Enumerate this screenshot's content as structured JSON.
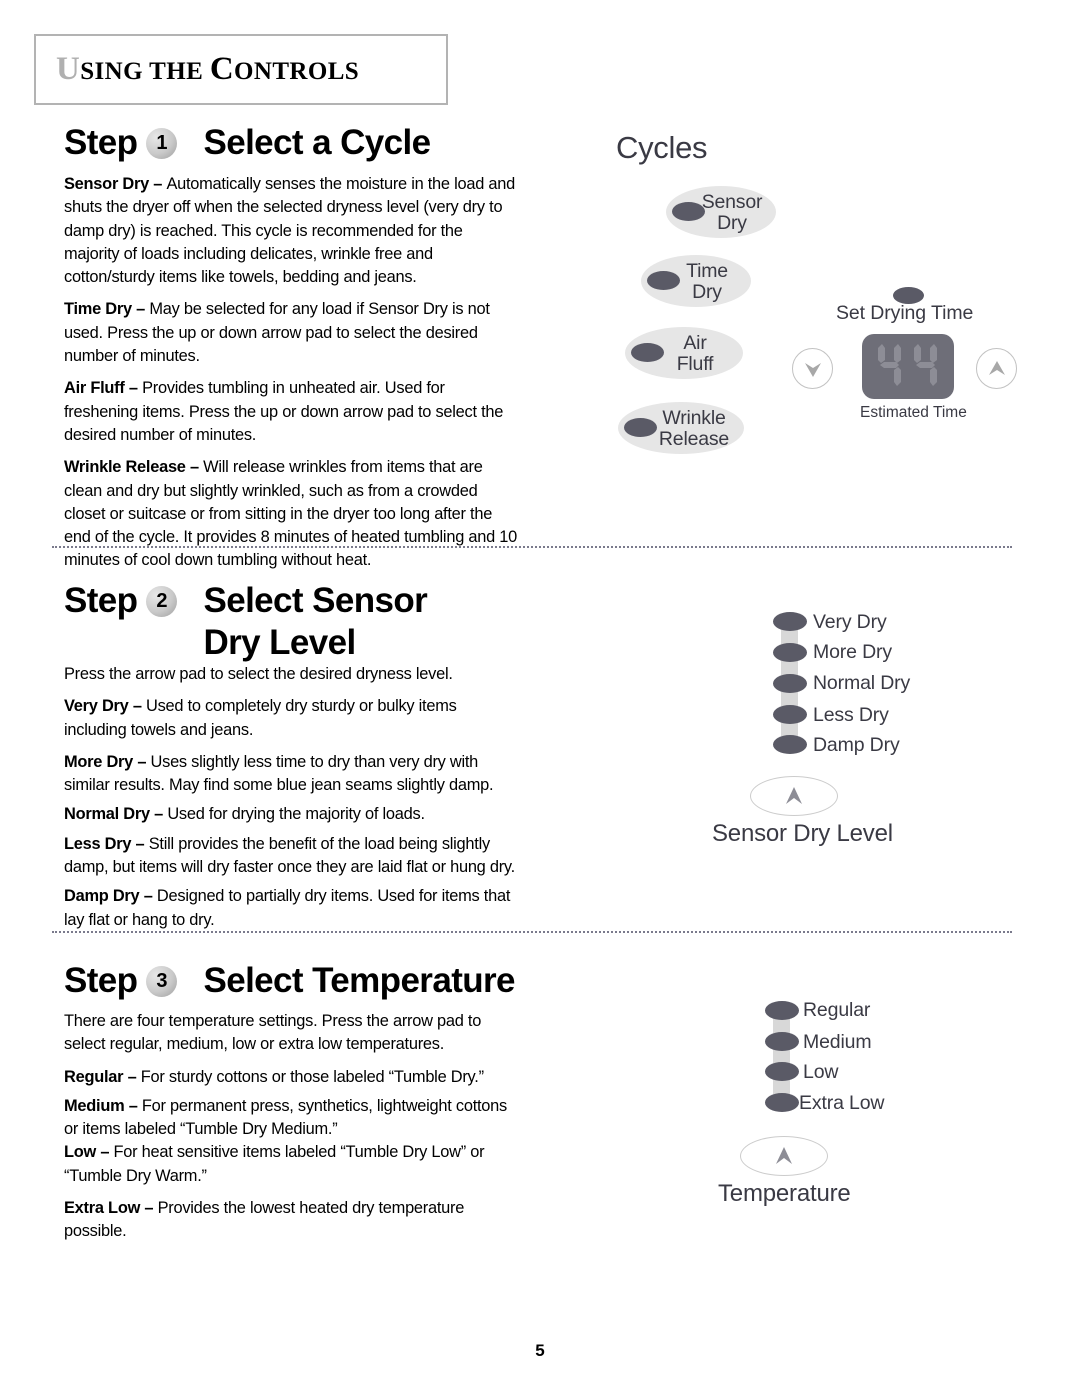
{
  "header": {
    "title_parts": {
      "u": "U",
      "rest1": "SING THE ",
      "c": "C",
      "rest2": "ONTROLS"
    },
    "title_full": "Using the Controls"
  },
  "page_number": "5",
  "steps": [
    {
      "step_word": "Step",
      "number": "1",
      "title": "Select a Cycle",
      "paragraphs": [
        {
          "term": "Sensor Dry",
          "dash": " – ",
          "text": "Automatically senses the moisture in the load and shuts the dryer off when the selected dryness level (very dry to damp dry) is reached. This cycle is recommended for the majority of loads including delicates, wrinkle free and cotton/sturdy items like towels, bedding and jeans."
        },
        {
          "term": "Time Dry",
          "dash": " – ",
          "text": "May be selected for any load if Sensor Dry is not used. Press the up or down arrow pad to select the desired number of minutes."
        },
        {
          "term": "Air Fluff",
          "dash": " – ",
          "text": "Provides tumbling in unheated air. Used for freshening items. Press the up or down arrow pad to select the desired number of minutes."
        },
        {
          "term": "Wrinkle Release",
          "dash": " – ",
          "text": "Will release wrinkles from items that are clean and dry but slightly wrinkled, such as from a crowded closet or suitcase or from sitting in the dryer too long after the end of the cycle. It provides 8 minutes of heated tumbling and 10 minutes of cool down tumbling without heat."
        }
      ]
    },
    {
      "step_word": "Step",
      "number": "2",
      "title_line1": "Select Sensor",
      "title_line2": "Dry Level",
      "paragraphs": [
        {
          "term": "",
          "dash": "",
          "text": "Press the arrow pad to select the desired dryness level."
        },
        {
          "term": "Very Dry",
          "dash": " – ",
          "text": "Used to completely dry sturdy or bulky items including towels and jeans."
        },
        {
          "term": "More Dry",
          "dash": " – ",
          "text": "Uses slightly less time to dry than very dry with similar results. May find some blue jean seams slightly damp."
        },
        {
          "term": "Normal Dry",
          "dash": " – ",
          "text": "Used for drying the majority of loads."
        },
        {
          "term": "Less Dry",
          "dash": " – ",
          "text": "Still provides the benefit of the load being slightly damp, but items will dry faster once they are laid flat or hung dry."
        },
        {
          "term": "Damp Dry",
          "dash": " – ",
          "text": "Designed to partially dry items. Used for items that lay flat or hang to dry."
        }
      ]
    },
    {
      "step_word": "Step",
      "number": "3",
      "title": "Select Temperature",
      "paragraphs": [
        {
          "term": "",
          "dash": "",
          "text": "There are four temperature settings. Press the arrow pad to select regular, medium, low or extra low temperatures."
        },
        {
          "term": "Regular",
          "dash": " – ",
          "text": "For sturdy cottons or those labeled “Tumble Dry.”"
        },
        {
          "term": "Medium",
          "dash": " – ",
          "text": "For permanent press, synthetics, lightweight cottons or items labeled “Tumble Dry Medium.”"
        },
        {
          "term": "Low",
          "dash": " – ",
          "text": "For heat sensitive items labeled “Tumble Dry Low” or “Tumble Dry Warm.”"
        },
        {
          "term": "Extra Low",
          "dash": " – ",
          "text": "Provides the lowest heated dry temperature possible."
        }
      ]
    }
  ],
  "cycles_panel": {
    "title": "Cycles",
    "options": [
      {
        "line1": "Sensor",
        "line2": "Dry"
      },
      {
        "line1": "Time",
        "line2": "Dry"
      },
      {
        "line1": "Air",
        "line2": "Fluff"
      },
      {
        "line1": "Wrinkle",
        "line2": "Release"
      }
    ],
    "set_drying_time_label": "Set Drying Time",
    "display_value": "44",
    "estimated_time_label": "Estimated Time",
    "down_pad": "down-arrow",
    "up_pad": "up-arrow"
  },
  "dry_level_panel": {
    "caption": "Sensor Dry Level",
    "levels": [
      "Very Dry",
      "More Dry",
      "Normal Dry",
      "Less Dry",
      "Damp Dry"
    ],
    "pad": "up-arrow"
  },
  "temperature_panel": {
    "caption": "Temperature",
    "levels": [
      "Regular",
      "Medium",
      "Low",
      "Extra Low"
    ],
    "pad": "up-arrow"
  },
  "colors": {
    "dot": "#5a5a66",
    "oval_bg": "#e6e6e6",
    "display_bg": "#6e6e78",
    "text_gray": "#3a3a44",
    "rule": "#7a7a8c"
  }
}
